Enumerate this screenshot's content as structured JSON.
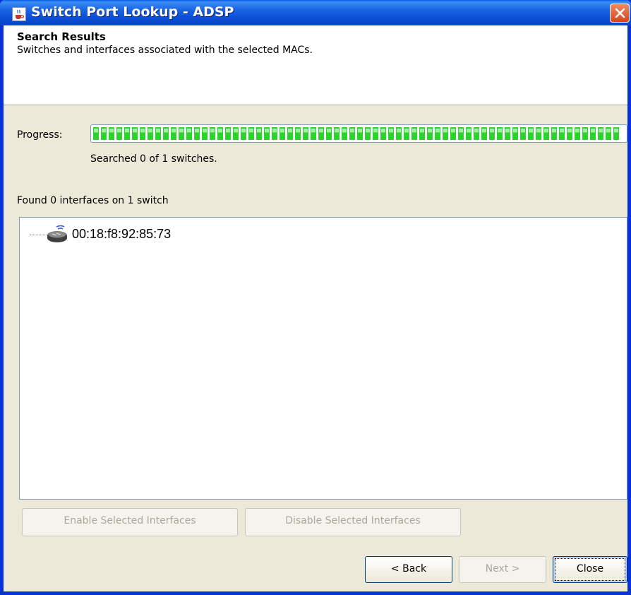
{
  "window": {
    "title": "Switch Port Lookup - ADSP",
    "app_icon": "java-cup-icon",
    "close_icon": "close-icon"
  },
  "header": {
    "title": "Search Results",
    "subtitle": "Switches and interfaces associated with the selected MACs."
  },
  "progress": {
    "label": "Progress:",
    "value": 1.0,
    "status": "Searched 0 of 1 switches.",
    "fill_color": "#2fd12f"
  },
  "results": {
    "summary": "Found 0 interfaces on 1 switch",
    "tree": [
      {
        "label": "00:18:f8:92:85:73",
        "icon": "network-switch-icon"
      }
    ]
  },
  "actions": {
    "enable_label": "Enable Selected Interfaces",
    "disable_label": "Disable Selected Interfaces"
  },
  "nav": {
    "back_label": "< Back",
    "next_label": "Next >",
    "close_label": "Close"
  }
}
